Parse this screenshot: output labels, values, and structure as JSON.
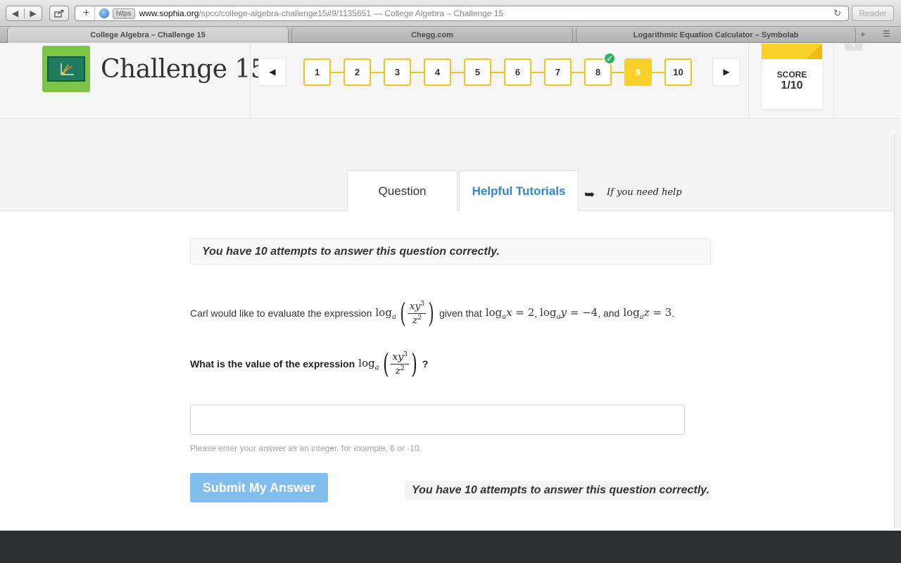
{
  "browser": {
    "nav_back": "◀",
    "nav_forward": "▶",
    "share_icon": "share-icon",
    "add_icon": "+",
    "https_label": "https",
    "url_host": "www.sophia.org",
    "url_path": "/spcc/college-algebra-challenge15#9/1135651",
    "url_title": "— College Algebra – Challenge 15",
    "reload_glyph": "↻",
    "reader_label": "Reader",
    "tabs": [
      {
        "label": "College Algebra – Challenge 15"
      },
      {
        "label": "Chegg.com"
      },
      {
        "label": "Logarithmic Equation Calculator – Symbolab"
      }
    ],
    "new_tab_glyph": "+",
    "tab_list_glyph": "☰"
  },
  "header": {
    "title": "Challenge 15",
    "prev_glyph": "◀",
    "next_glyph": "▶",
    "questions": [
      "1",
      "2",
      "3",
      "4",
      "5",
      "6",
      "7",
      "8",
      "9",
      "10"
    ],
    "current_question": "9",
    "answered_correct": "8",
    "check_glyph": "✓",
    "score_label": "SCORE",
    "score_value": "1/10",
    "accent_color": "#fcd02b",
    "close_glyph": "×"
  },
  "tabs": {
    "question_label": "Question",
    "tutorials_label": "Helpful Tutorials",
    "help_arrow": "➥",
    "help_text": "If you need help"
  },
  "question": {
    "attempts_banner": "You have 10 attempts to answer this question correctly.",
    "intro_text": "Carl would like to evaluate the expression",
    "given_text": "given that",
    "and_text": ", and",
    "prompt_text": "What is the value of the expression",
    "question_mark": "?",
    "math": {
      "log": "log",
      "base": "a",
      "frac_num_x": "xy",
      "frac_num_exp": "3",
      "frac_den": "z",
      "frac_den_exp": "2",
      "cond1_var": "x",
      "cond1_val": "2",
      "cond2_var": "y",
      "cond2_val": "−4",
      "cond3_var": "z",
      "cond3_val": "3",
      "equals": "="
    },
    "answer_value": "",
    "answer_placeholder": "",
    "hint": "Please enter your answer as an integer, for example, 6 or -10.",
    "submit_label": "Submit My Answer",
    "attempts_footer": "You have 10 attempts to answer this question correctly."
  }
}
